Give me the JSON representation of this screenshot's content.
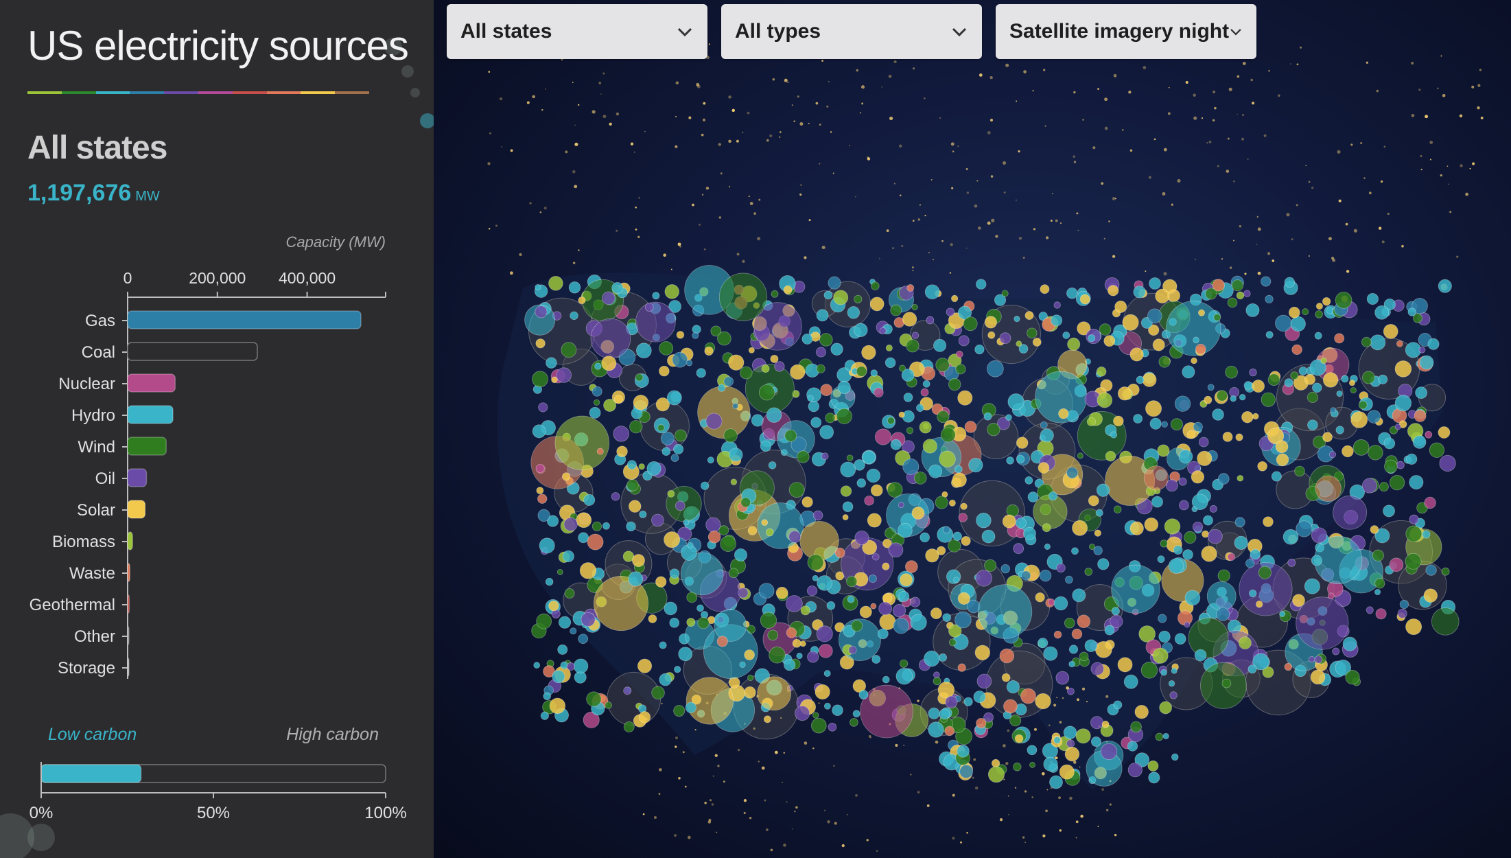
{
  "app": {
    "title": "US electricity sources",
    "title_rule_colors": [
      "#9cc43b",
      "#2b8a2b",
      "#3ab4c8",
      "#2e7fa8",
      "#6b4ba8",
      "#b34a9a",
      "#c8504a",
      "#e07a5a",
      "#f2c94c",
      "#a0714a"
    ]
  },
  "summary": {
    "state_name": "All states",
    "total_value": "1,197,676",
    "total_unit": "MW"
  },
  "filters": {
    "state": "All states",
    "type": "All types",
    "basemap": "Satellite imagery night"
  },
  "chart_data": [
    {
      "type": "bar",
      "orientation": "horizontal",
      "title": "Capacity (MW)",
      "xticks": [
        "0",
        "200,000",
        "400,000"
      ],
      "xlim": [
        0,
        575000
      ],
      "categories": [
        "Gas",
        "Coal",
        "Nuclear",
        "Hydro",
        "Wind",
        "Oil",
        "Solar",
        "Biomass",
        "Waste",
        "Geothermal",
        "Other",
        "Storage"
      ],
      "values": [
        520000,
        289000,
        106000,
        101000,
        86000,
        42000,
        39000,
        11000,
        5000,
        3700,
        1000,
        500
      ],
      "colors": [
        "#2e7fa8",
        "#2c2c2f",
        "#b34a8a",
        "#3ab4c8",
        "#2f7d1e",
        "#6b4ba8",
        "#f2c94c",
        "#9cc43b",
        "#e07a5a",
        "#c8504a",
        "#888888",
        "#aaaaaa"
      ]
    },
    {
      "type": "bar",
      "orientation": "horizontal",
      "stacked": true,
      "labels": [
        "Low carbon",
        "High carbon"
      ],
      "label_colors": [
        "#3ab4c8",
        "#b0b0b0"
      ],
      "values": [
        29,
        71
      ],
      "xticks": [
        "0%",
        "50%",
        "100%"
      ],
      "xlim": [
        0,
        100
      ]
    }
  ]
}
